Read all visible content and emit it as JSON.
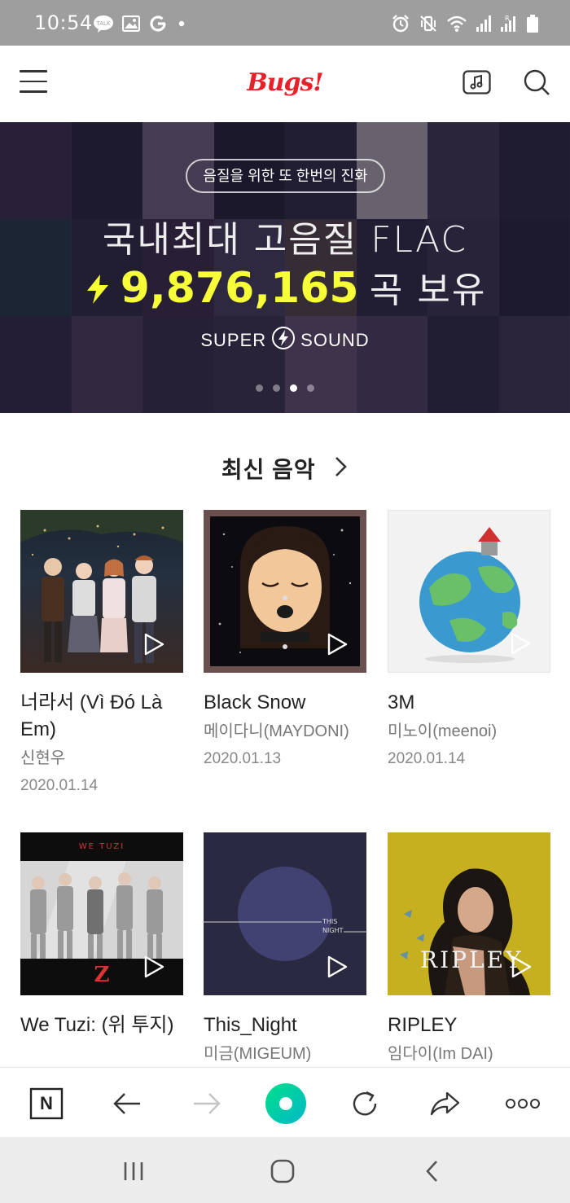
{
  "status_bar": {
    "time": "10:54",
    "left_icons": [
      "kakaotalk-icon",
      "gallery-icon",
      "google-icon",
      "dot-icon"
    ],
    "right_icons": [
      "alarm-icon",
      "vibrate-icon",
      "wifi-icon",
      "signal-icon",
      "signal-roaming-icon",
      "battery-icon"
    ]
  },
  "header": {
    "logo": "Bugs!",
    "menu_icon": "hamburger-menu-icon",
    "music_icon": "music-note-icon",
    "search_icon": "search-icon"
  },
  "banner": {
    "pill_text": "음질을 위한 또 한번의 진화",
    "headline": "국내최대 고음질 FLAC",
    "count": "9,876,165",
    "count_suffix": "곡 보유",
    "brand_left": "SUPER",
    "brand_right": "SOUND",
    "slides_total": 4,
    "active_slide": 3
  },
  "section": {
    "title": "최신 음악"
  },
  "albums": [
    {
      "title": "너라서 (Vì Đó Là Em)",
      "artist": "신현우",
      "date": "2020.01.14"
    },
    {
      "title": "Black Snow",
      "artist": "메이다니(MAYDONI)",
      "date": "2020.01.13"
    },
    {
      "title": "3M",
      "artist": "미노이(meenoi)",
      "date": "2020.01.14"
    },
    {
      "title": "We Tuzi: (위 투지)",
      "artist": "",
      "date": ""
    },
    {
      "title": "This_Night",
      "artist": "미금(MIGEUM)",
      "date": ""
    },
    {
      "title": "RIPLEY",
      "artist": "임다이(Im DAI)",
      "date": ""
    }
  ],
  "cover_text": {
    "wetuzi_top": "WE TUZI",
    "wetuzi_logo": "Z",
    "thisnight": "THIS\nNIGHT",
    "ripley": "RIPLEY"
  },
  "toolbar": {
    "naver_label": "N",
    "icons": [
      "naver-home-icon",
      "back-arrow-icon",
      "forward-arrow-icon",
      "green-dot-icon",
      "refresh-icon",
      "share-icon",
      "more-icon"
    ],
    "accent": "#00d08b"
  },
  "android_nav": {
    "icons": [
      "recent-apps-icon",
      "home-icon",
      "back-icon"
    ]
  },
  "colors": {
    "brand": "#e8202a",
    "banner_highlight": "#f6ff38"
  }
}
